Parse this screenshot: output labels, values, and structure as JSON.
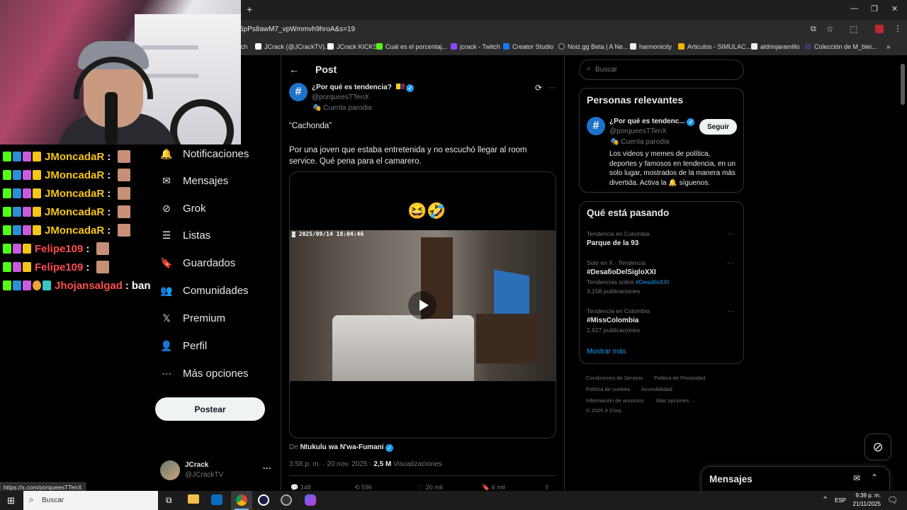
{
  "browser": {
    "url": "5pPs8awM7_vpWmmvh9hroA&s=19",
    "new_tab": "+",
    "bookmarks": [
      {
        "label": "ch"
      },
      {
        "label": "JCrack (@JCrackTV)..."
      },
      {
        "label": "JCrack KICKS"
      },
      {
        "label": "Cuál es el porcentaj..."
      },
      {
        "label": "jcrack - Twitch"
      },
      {
        "label": "Creator Studio"
      },
      {
        "label": "Noiz.gg Beta | A Ne..."
      },
      {
        "label": "harmonicity"
      },
      {
        "label": "Articulos - SIMULAC..."
      },
      {
        "label": "aldrinjaramillo"
      },
      {
        "label": "Colección de M_blei..."
      }
    ]
  },
  "chat": {
    "lines": [
      {
        "user": "JMoncadaR",
        "color": "#f5c518"
      },
      {
        "user": "JMoncadaR",
        "color": "#f5c518"
      },
      {
        "user": "JMoncadaR",
        "color": "#f5c518"
      },
      {
        "user": "JMoncadaR",
        "color": "#f5c518"
      },
      {
        "user": "JMoncadaR",
        "color": "#f5c518"
      },
      {
        "user": "Felipe109",
        "color": "#ff4d4d"
      },
      {
        "user": "Felipe109",
        "color": "#ff4d4d"
      },
      {
        "user": "Jhojansalgad",
        "color": "#ff4d4d",
        "message": "ban"
      }
    ],
    "separator": ":"
  },
  "nav": {
    "items": [
      {
        "label": "Notificaciones",
        "icon": "bell-icon"
      },
      {
        "label": "Mensajes",
        "icon": "envelope-icon"
      },
      {
        "label": "Grok",
        "icon": "grok-icon"
      },
      {
        "label": "Listas",
        "icon": "list-icon"
      },
      {
        "label": "Guardados",
        "icon": "bookmark-icon"
      },
      {
        "label": "Comunidades",
        "icon": "communities-icon"
      },
      {
        "label": "Premium",
        "icon": "x-logo-icon"
      },
      {
        "label": "Perfil",
        "icon": "person-icon"
      },
      {
        "label": "Más opciones",
        "icon": "more-circle-icon"
      }
    ],
    "post_button": "Postear",
    "account": {
      "name": "JCrack",
      "handle": "@JCrackTV",
      "more": "···"
    }
  },
  "post": {
    "header": "Post",
    "author": {
      "name": "¿Por qué es tendencia?",
      "handle": "@porqueesTTenX",
      "label": "Cuenta parodia"
    },
    "text1": "“Cachonda”",
    "text2": "Por una joven que estaba entretenida y no escuchó llegar al room service. Qué pena para el camarero.",
    "media": {
      "emoji": "😆🤣",
      "timestamp": "2025/09/14 18:04:46"
    },
    "from_prefix": "De",
    "from_name": "Ntukulu wa N'wa-Fumani",
    "time": "3:58 p. m. · 20 nov. 2025 ·",
    "views_count": "2,5 M",
    "views_label": "Visualizaciones",
    "actions": {
      "replies": "148",
      "reposts": "596",
      "likes": "20 mil",
      "bookmarks": "6 mil"
    }
  },
  "right": {
    "search_placeholder": "Buscar",
    "relevant": {
      "title": "Personas relevantes",
      "name": "¿Por qué es tendenc...",
      "handle": "@porqueesTTenX",
      "label": "Cuenta parodia",
      "follow": "Seguir",
      "bio": "Los videos y memes de política, deportes y famosos en tendencia, en un solo lugar, mostrados de la manera más divertida. Activa la 🔔 síguenos."
    },
    "trending": {
      "title": "Qué está pasando",
      "items": [
        {
          "context": "Tendencia en Colombia",
          "name": "Parque de la 93",
          "extra": ""
        },
        {
          "context": "Solo en X · Tendencia",
          "name": "#DesafioDelSigloXXI",
          "extra_prefix": "Tendencias sobre",
          "extra_tag": "#DesafioXXI",
          "count": "3,158 publicaciones"
        },
        {
          "context": "Tendencia en Colombia",
          "name": "#MissColombia",
          "count": "2,627 publicaciones"
        }
      ],
      "show_more": "Mostrar más"
    },
    "footer": {
      "links": [
        "Condiciones de Servicio",
        "Política de Privacidad",
        "Política de cookies",
        "Accesibilidad",
        "Información de anuncios",
        "Más opciones ···"
      ],
      "copyright": "© 2025 X Corp."
    },
    "messages": "Mensajes"
  },
  "status_bar": "https://x.com/porqueesTTenX",
  "taskbar": {
    "search": "Buscar",
    "lang": "ESP",
    "time": "9:39 p. m.",
    "date": "21/11/2025"
  }
}
